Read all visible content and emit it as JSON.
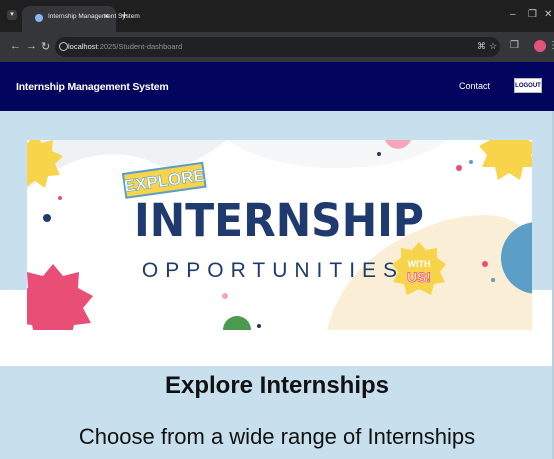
{
  "browser": {
    "tab_title": "Internship Management System",
    "tab_close": "×",
    "new_tab": "+",
    "url_host": "localhost",
    "url_path": ":2025/Student-dashboard"
  },
  "navbar": {
    "brand": "Internship Management System",
    "contact": "Contact",
    "logout": "LOGOUT"
  },
  "banner": {
    "badge_text": "EXPLORE",
    "headline": "INTERNSHIP",
    "subline": "OPPORTUNITIES",
    "sticker_line1": "WITH",
    "sticker_line2": "US!"
  },
  "main": {
    "heading": "Explore Internships",
    "subheading": "Choose from a wide range of Internships"
  },
  "colors": {
    "navbar": "#03045e",
    "hero_background": "#c8e0ee",
    "headline_navy": "#1f3a6e",
    "badge_yellow": "#f7d44a",
    "accent_pink": "#e94e77",
    "accent_teal": "#5b9ec6"
  }
}
